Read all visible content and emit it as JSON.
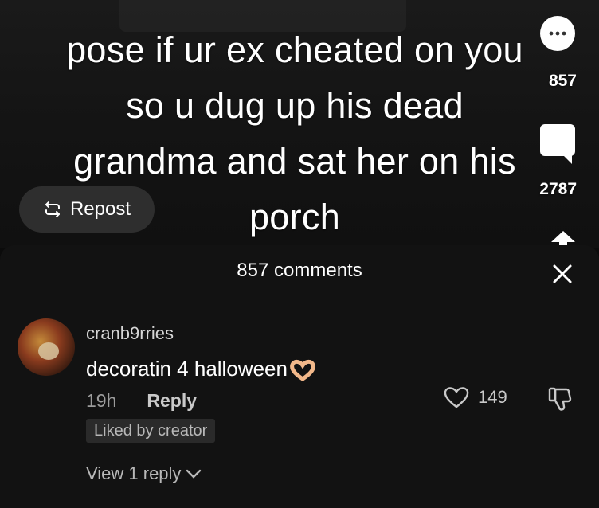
{
  "video": {
    "caption": "pose if ur ex cheated on you\nso u dug up his dead\ngrandma and sat her on his\nporch",
    "repost_label": "Repost",
    "likes_count": "857",
    "comments_count": "2787"
  },
  "comments_panel": {
    "title": "857 comments",
    "comment": {
      "username": "cranb9rries",
      "text": "decoratin 4 halloween",
      "time": "19h",
      "reply_label": "Reply",
      "liked_badge": "Liked by creator",
      "like_count": "149"
    },
    "view_replies_label": "View 1 reply"
  },
  "colors": {
    "panel_bg": "#121212",
    "badge_bg": "#2a2a2a",
    "repost_bg": "#2e2e2e"
  }
}
